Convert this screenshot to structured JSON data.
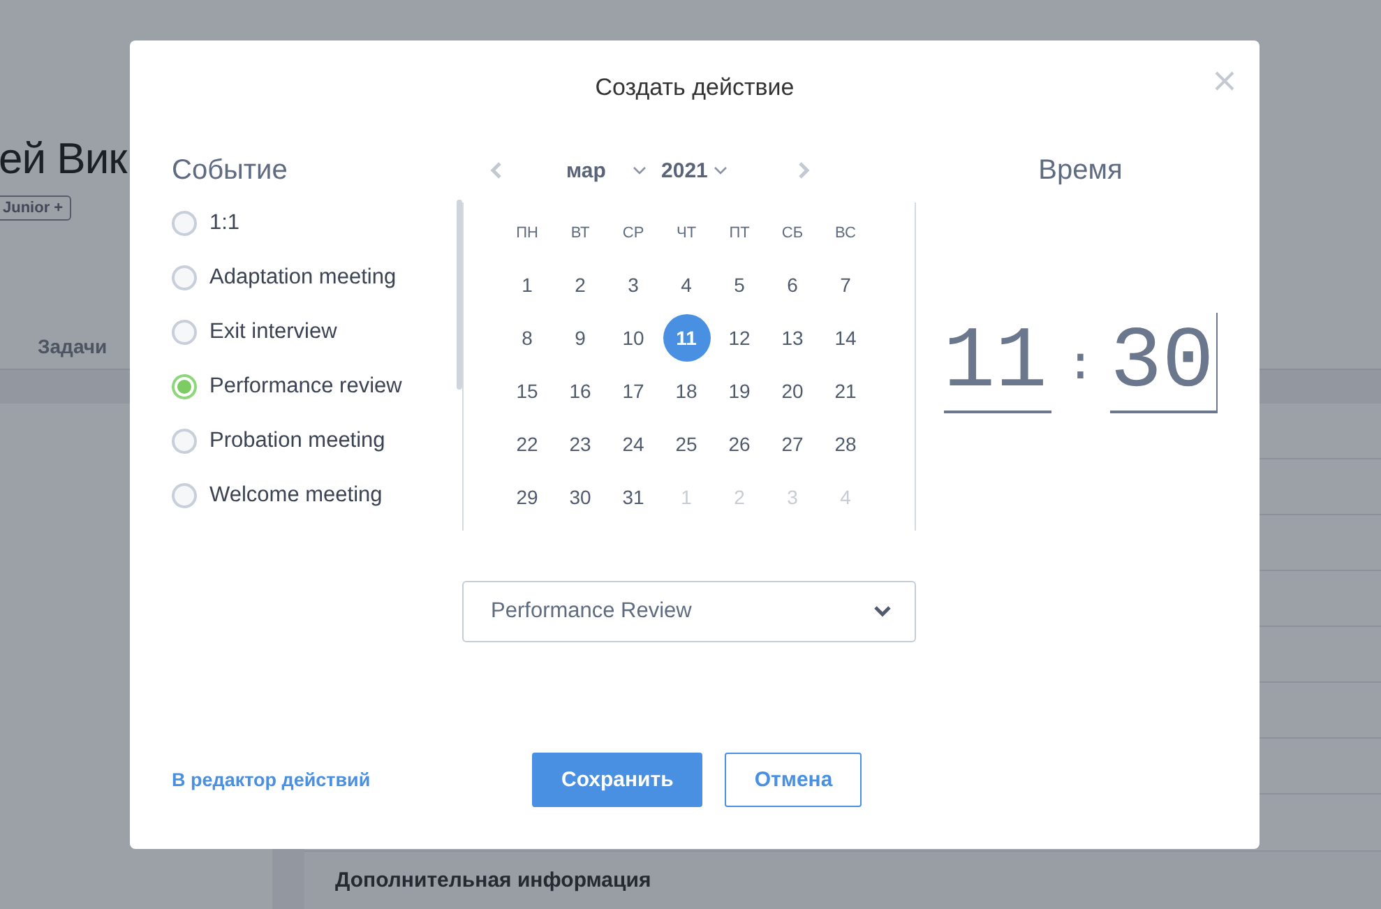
{
  "background": {
    "heading": "ей Вик",
    "badge": "Junior +",
    "tab": "Задачи",
    "section_title": "Дополнительная информация"
  },
  "dialog": {
    "title": "Создать действие",
    "event": {
      "heading": "Событие",
      "options": [
        {
          "label": "1:1",
          "selected": false
        },
        {
          "label": "Adaptation meeting",
          "selected": false
        },
        {
          "label": "Exit interview",
          "selected": false
        },
        {
          "label": "Performance review",
          "selected": true
        },
        {
          "label": "Probation meeting",
          "selected": false
        },
        {
          "label": "Welcome meeting",
          "selected": false
        }
      ]
    },
    "calendar": {
      "month": "мар",
      "year": "2021",
      "weekdays": [
        "ПН",
        "ВТ",
        "СР",
        "ЧТ",
        "ПТ",
        "СБ",
        "ВС"
      ],
      "days": [
        {
          "label": "1",
          "kind": "current",
          "selected": false
        },
        {
          "label": "2",
          "kind": "current",
          "selected": false
        },
        {
          "label": "3",
          "kind": "current",
          "selected": false
        },
        {
          "label": "4",
          "kind": "current",
          "selected": false
        },
        {
          "label": "5",
          "kind": "current",
          "selected": false
        },
        {
          "label": "6",
          "kind": "current",
          "selected": false
        },
        {
          "label": "7",
          "kind": "current",
          "selected": false
        },
        {
          "label": "8",
          "kind": "current",
          "selected": false
        },
        {
          "label": "9",
          "kind": "current",
          "selected": false
        },
        {
          "label": "10",
          "kind": "current",
          "selected": false
        },
        {
          "label": "11",
          "kind": "current",
          "selected": true
        },
        {
          "label": "12",
          "kind": "current",
          "selected": false
        },
        {
          "label": "13",
          "kind": "current",
          "selected": false
        },
        {
          "label": "14",
          "kind": "current",
          "selected": false
        },
        {
          "label": "15",
          "kind": "current",
          "selected": false
        },
        {
          "label": "16",
          "kind": "current",
          "selected": false
        },
        {
          "label": "17",
          "kind": "current",
          "selected": false
        },
        {
          "label": "18",
          "kind": "current",
          "selected": false
        },
        {
          "label": "19",
          "kind": "current",
          "selected": false
        },
        {
          "label": "20",
          "kind": "current",
          "selected": false
        },
        {
          "label": "21",
          "kind": "current",
          "selected": false
        },
        {
          "label": "22",
          "kind": "current",
          "selected": false
        },
        {
          "label": "23",
          "kind": "current",
          "selected": false
        },
        {
          "label": "24",
          "kind": "current",
          "selected": false
        },
        {
          "label": "25",
          "kind": "current",
          "selected": false
        },
        {
          "label": "26",
          "kind": "current",
          "selected": false
        },
        {
          "label": "27",
          "kind": "current",
          "selected": false
        },
        {
          "label": "28",
          "kind": "current",
          "selected": false
        },
        {
          "label": "29",
          "kind": "current",
          "selected": false
        },
        {
          "label": "30",
          "kind": "current",
          "selected": false
        },
        {
          "label": "31",
          "kind": "current",
          "selected": false
        },
        {
          "label": "1",
          "kind": "next",
          "selected": false
        },
        {
          "label": "2",
          "kind": "next",
          "selected": false
        },
        {
          "label": "3",
          "kind": "next",
          "selected": false
        },
        {
          "label": "4",
          "kind": "next",
          "selected": false
        }
      ]
    },
    "time": {
      "heading": "Время",
      "hours": "11",
      "separator": ":",
      "minutes": "30"
    },
    "type_select": {
      "value": "Performance Review"
    },
    "editor_link": "В редактор действий",
    "buttons": [
      {
        "label": "Сохранить",
        "kind": "primary"
      },
      {
        "label": "Отмена",
        "kind": "secondary"
      }
    ]
  }
}
